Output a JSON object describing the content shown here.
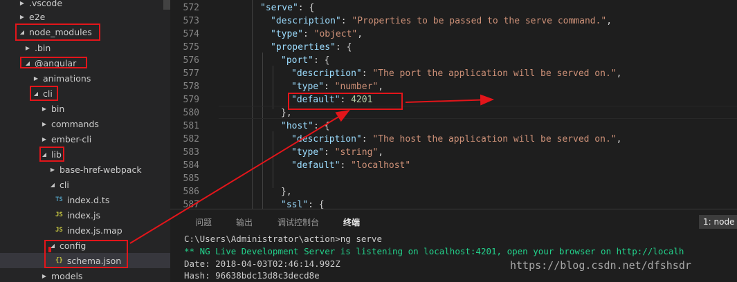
{
  "sidebar": {
    "items": [
      {
        "label": ".vscode",
        "twisty": "▶",
        "icon": "",
        "icon_class": ""
      },
      {
        "label": "e2e",
        "twisty": "▶",
        "icon": "",
        "icon_class": ""
      },
      {
        "label": "node_modules",
        "twisty": "◢",
        "icon": "",
        "icon_class": ""
      },
      {
        "label": ".bin",
        "twisty": "▶",
        "icon": "",
        "icon_class": ""
      },
      {
        "label": "@angular",
        "twisty": "◢",
        "icon": "",
        "icon_class": ""
      },
      {
        "label": "animations",
        "twisty": "▶",
        "icon": "",
        "icon_class": ""
      },
      {
        "label": "cli",
        "twisty": "◢",
        "icon": "",
        "icon_class": ""
      },
      {
        "label": "bin",
        "twisty": "▶",
        "icon": "",
        "icon_class": ""
      },
      {
        "label": "commands",
        "twisty": "▶",
        "icon": "",
        "icon_class": ""
      },
      {
        "label": "ember-cli",
        "twisty": "▶",
        "icon": "",
        "icon_class": ""
      },
      {
        "label": "lib",
        "twisty": "◢",
        "icon": "",
        "icon_class": ""
      },
      {
        "label": "base-href-webpack",
        "twisty": "▶",
        "icon": "",
        "icon_class": ""
      },
      {
        "label": "cli",
        "twisty": "◢",
        "icon": "",
        "icon_class": ""
      },
      {
        "label": "index.d.ts",
        "twisty": "",
        "icon": "TS",
        "icon_class": "icon-ts"
      },
      {
        "label": "index.js",
        "twisty": "",
        "icon": "JS",
        "icon_class": "icon-js"
      },
      {
        "label": "index.js.map",
        "twisty": "",
        "icon": "JS",
        "icon_class": "icon-js"
      },
      {
        "label": "config",
        "twisty": "◢",
        "icon": "",
        "icon_class": ""
      },
      {
        "label": "schema.json",
        "twisty": "",
        "icon": "{}",
        "icon_class": "icon-json"
      },
      {
        "label": "models",
        "twisty": "▶",
        "icon": "",
        "icon_class": ""
      }
    ]
  },
  "editor": {
    "lines": [
      {
        "n": "572",
        "tokens": [
          [
            "k",
            "\"serve\""
          ],
          [
            "p",
            ": {"
          ]
        ]
      },
      {
        "n": "573",
        "tokens": [
          [
            "k",
            "\"description\""
          ],
          [
            "p",
            ": "
          ],
          [
            "s",
            "\"Properties to be passed to the serve command.\""
          ],
          [
            "p",
            ","
          ]
        ]
      },
      {
        "n": "574",
        "tokens": [
          [
            "k",
            "\"type\""
          ],
          [
            "p",
            ": "
          ],
          [
            "s",
            "\"object\""
          ],
          [
            "p",
            ","
          ]
        ]
      },
      {
        "n": "575",
        "tokens": [
          [
            "k",
            "\"properties\""
          ],
          [
            "p",
            ": {"
          ]
        ]
      },
      {
        "n": "576",
        "tokens": [
          [
            "k",
            "\"port\""
          ],
          [
            "p",
            ": {"
          ]
        ]
      },
      {
        "n": "577",
        "tokens": [
          [
            "k",
            "\"description\""
          ],
          [
            "p",
            ": "
          ],
          [
            "s",
            "\"The port the application will be served on.\""
          ],
          [
            "p",
            ","
          ]
        ]
      },
      {
        "n": "578",
        "tokens": [
          [
            "k",
            "\"type\""
          ],
          [
            "p",
            ": "
          ],
          [
            "s",
            "\"number\""
          ],
          [
            "p",
            ","
          ]
        ]
      },
      {
        "n": "579",
        "tokens": [
          [
            "k",
            "\"default\""
          ],
          [
            "p",
            ": "
          ],
          [
            "n",
            "4201"
          ]
        ]
      },
      {
        "n": "580",
        "tokens": [
          [
            "p",
            "},"
          ]
        ]
      },
      {
        "n": "581",
        "tokens": [
          [
            "k",
            "\"host\""
          ],
          [
            "p",
            ": {"
          ]
        ]
      },
      {
        "n": "582",
        "tokens": [
          [
            "k",
            "\"description\""
          ],
          [
            "p",
            ": "
          ],
          [
            "s",
            "\"The host the application will be served on.\""
          ],
          [
            "p",
            ","
          ]
        ]
      },
      {
        "n": "583",
        "tokens": [
          [
            "k",
            "\"type\""
          ],
          [
            "p",
            ": "
          ],
          [
            "s",
            "\"string\""
          ],
          [
            "p",
            ","
          ]
        ]
      },
      {
        "n": "584",
        "tokens": [
          [
            "k",
            "\"default\""
          ],
          [
            "p",
            ": "
          ],
          [
            "s",
            "\"localhost\""
          ]
        ]
      },
      {
        "n": "585",
        "tokens": []
      },
      {
        "n": "586",
        "tokens": [
          [
            "p",
            "},"
          ]
        ]
      },
      {
        "n": "587",
        "tokens": [
          [
            "k",
            "\"ssl\""
          ],
          [
            "p",
            ": {"
          ]
        ]
      }
    ]
  },
  "panel": {
    "tabs": [
      "问题",
      "输出",
      "调试控制台",
      "终端"
    ],
    "active_tab": "终端",
    "terminal_select": "1: node",
    "terminal_lines": [
      {
        "text": "C:\\Users\\Administrator\\action>ng serve",
        "style": "normal"
      },
      {
        "text": "** NG Live Development Server is listening on localhost:4201, open your browser on http://localh",
        "style": "green"
      },
      {
        "text": "Date: 2018-04-03T02:46:14.992Z",
        "style": "normal"
      },
      {
        "text": "Hash: 96638bdc13d8c3decd8e",
        "style": "normal"
      }
    ]
  },
  "watermark": "https://blog.csdn.net/dfshsdr",
  "colors": {
    "annotation_red": "#e3151a",
    "keyword": "#9cdcfe",
    "string": "#ce9178",
    "number": "#b5cea8",
    "terminal_green": "#23d18b"
  }
}
